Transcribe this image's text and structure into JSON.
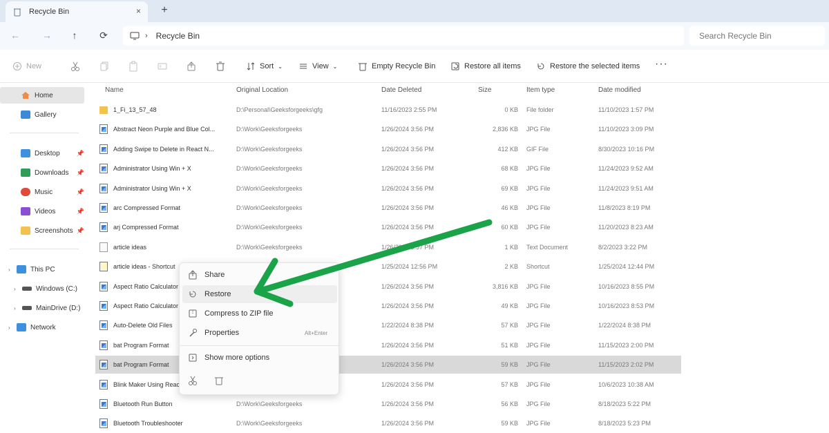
{
  "tab": {
    "title": "Recycle Bin",
    "close": "×",
    "new_tab": "+"
  },
  "nav": {
    "back": "←",
    "forward": "→",
    "up": "↑",
    "refresh": "⟳"
  },
  "address": {
    "path": "Recycle Bin"
  },
  "search": {
    "placeholder": "Search Recycle Bin"
  },
  "toolbar": {
    "new_label": "New",
    "sort_label": "Sort",
    "view_label": "View",
    "empty_label": "Empty Recycle Bin",
    "restore_all_label": "Restore all items",
    "restore_selected_label": "Restore the selected items",
    "more": "···"
  },
  "sidebar": {
    "home": "Home",
    "gallery": "Gallery",
    "desktop": "Desktop",
    "downloads": "Downloads",
    "music": "Music",
    "videos": "Videos",
    "screenshots": "Screenshots",
    "this_pc": "This PC",
    "windows_c": "Windows (C:)",
    "main_drive": "MainDrive (D:)",
    "network": "Network"
  },
  "columns": {
    "name": "Name",
    "original_location": "Original Location",
    "date_deleted": "Date Deleted",
    "size": "Size",
    "item_type": "Item type",
    "date_modified": "Date modified"
  },
  "rows": [
    {
      "name": "1_Fi_13_57_48",
      "location": "D:\\Personal\\Geeksforgeeks\\gfg",
      "deleted": "11/16/2023 2:55 PM",
      "size": "0 KB",
      "type": "File folder",
      "modified": "11/10/2023 1:57 PM",
      "icon": "folder"
    },
    {
      "name": "Abstract Neon Purple and Blue Col...",
      "location": "D:\\Work\\Geeksforgeeks",
      "deleted": "1/26/2024 3:56 PM",
      "size": "2,836 KB",
      "type": "JPG File",
      "modified": "11/10/2023 3:09 PM",
      "icon": "img"
    },
    {
      "name": "Adding Swipe to Delete in React N...",
      "location": "D:\\Work\\Geeksforgeeks",
      "deleted": "1/26/2024 3:56 PM",
      "size": "412 KB",
      "type": "GIF File",
      "modified": "8/30/2023 10:16 PM",
      "icon": "img"
    },
    {
      "name": "Administrator Using Win + X",
      "location": "D:\\Work\\Geeksforgeeks",
      "deleted": "1/26/2024 3:56 PM",
      "size": "68 KB",
      "type": "JPG File",
      "modified": "11/24/2023 9:52 AM",
      "icon": "img"
    },
    {
      "name": "Administrator Using Win + X",
      "location": "D:\\Work\\Geeksforgeeks",
      "deleted": "1/26/2024 3:56 PM",
      "size": "69 KB",
      "type": "JPG File",
      "modified": "11/24/2023 9:51 AM",
      "icon": "img"
    },
    {
      "name": "arc Compressed Format",
      "location": "D:\\Work\\Geeksforgeeks",
      "deleted": "1/26/2024 3:56 PM",
      "size": "46 KB",
      "type": "JPG File",
      "modified": "11/8/2023 8:19 PM",
      "icon": "img"
    },
    {
      "name": "arj Compressed Format",
      "location": "D:\\Work\\Geeksforgeeks",
      "deleted": "1/26/2024 3:56 PM",
      "size": "60 KB",
      "type": "JPG File",
      "modified": "11/20/2023 8:23 AM",
      "icon": "img"
    },
    {
      "name": "article ideas",
      "location": "D:\\Work\\Geeksforgeeks",
      "deleted": "1/26/2024 3:57 PM",
      "size": "1 KB",
      "type": "Text Document",
      "modified": "8/2/2023 3:22 PM",
      "icon": "txt"
    },
    {
      "name": "article ideas - Shortcut",
      "location": "",
      "deleted": "1/25/2024 12:56 PM",
      "size": "2 KB",
      "type": "Shortcut",
      "modified": "1/25/2024 12:44 PM",
      "icon": "lnk"
    },
    {
      "name": "Aspect Ratio Calculator",
      "location": "",
      "deleted": "1/26/2024 3:56 PM",
      "size": "3,816 KB",
      "type": "JPG File",
      "modified": "10/16/2023 8:55 PM",
      "icon": "img"
    },
    {
      "name": "Aspect Ratio Calculator",
      "location": "",
      "deleted": "1/26/2024 3:56 PM",
      "size": "49 KB",
      "type": "JPG File",
      "modified": "10/16/2023 8:53 PM",
      "icon": "img"
    },
    {
      "name": "Auto-Delete Old Files",
      "location": "",
      "deleted": "1/22/2024 8:38 PM",
      "size": "57 KB",
      "type": "JPG File",
      "modified": "1/22/2024 8:38 PM",
      "icon": "img"
    },
    {
      "name": "bat Program Format",
      "location": "",
      "deleted": "1/26/2024 3:56 PM",
      "size": "51 KB",
      "type": "JPG File",
      "modified": "11/15/2023 2:00 PM",
      "icon": "img"
    },
    {
      "name": "bat Program Format",
      "location": "",
      "deleted": "1/26/2024 3:56 PM",
      "size": "59 KB",
      "type": "JPG File",
      "modified": "11/15/2023 2:02 PM",
      "icon": "img"
    },
    {
      "name": "Blink Maker Using React",
      "location": "",
      "deleted": "1/26/2024 3:56 PM",
      "size": "57 KB",
      "type": "JPG File",
      "modified": "10/6/2023 10:38 AM",
      "icon": "img"
    },
    {
      "name": "Bluetooth Run Button",
      "location": "D:\\Work\\Geeksforgeeks",
      "deleted": "1/26/2024 3:56 PM",
      "size": "56 KB",
      "type": "JPG File",
      "modified": "8/18/2023 5:22 PM",
      "icon": "img"
    },
    {
      "name": "Bluetooth Troubleshooter",
      "location": "D:\\Work\\Geeksforgeeks",
      "deleted": "1/26/2024 3:56 PM",
      "size": "59 KB",
      "type": "JPG File",
      "modified": "8/18/2023 5:23 PM",
      "icon": "img"
    }
  ],
  "context_menu": {
    "share": "Share",
    "restore": "Restore",
    "compress": "Compress to ZIP file",
    "properties": "Properties",
    "properties_shortcut": "Alt+Enter",
    "show_more": "Show more options"
  },
  "colors": {
    "accent": "#0067c0",
    "arrow": "#1ba34a",
    "selection": "#d9d9d9"
  }
}
